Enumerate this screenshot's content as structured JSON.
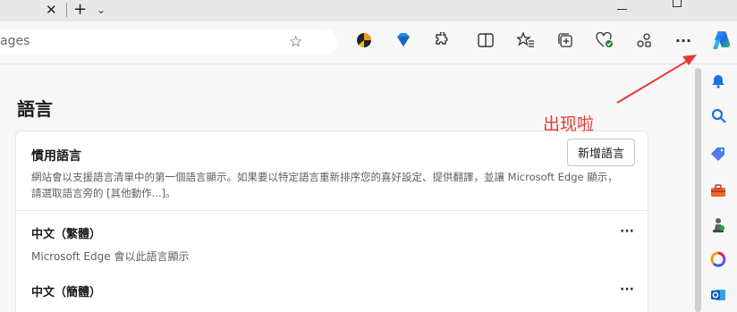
{
  "tabstrip": {
    "close_glyph": "✕",
    "newtab_glyph": "+",
    "tablist_glyph": "⌄"
  },
  "address": {
    "text": "ages"
  },
  "toolbar_icons": [
    "star-icon",
    "extension-colorful-icon",
    "extension-diamond-icon",
    "extensions-icon",
    "split-screen-icon",
    "favorites-icon",
    "collections-icon",
    "browser-essentials-icon",
    "share-icon",
    "more-icon",
    "copilot-icon"
  ],
  "content": {
    "title": "語言",
    "preferred": {
      "heading": "慣用語言",
      "add_button": "新增語言",
      "description": "網站會以支援語言清單中的第一個語言顯示。如果要以特定語言重新排序您的喜好設定、提供翻譯，並讓 Microsoft Edge 顯示，請選取語言旁的 [其他動作...]。"
    },
    "languages": [
      {
        "name": "中文（繁體）",
        "note": "Microsoft Edge 會以此語言顯示"
      },
      {
        "name": "中文（簡體）",
        "note": ""
      }
    ],
    "more_label": "···"
  },
  "annotation": {
    "text": "出现啦",
    "color": "#e53935"
  },
  "sidebar_icons": [
    "bell-icon",
    "search-icon",
    "tag-icon",
    "toolbox-icon",
    "games-icon",
    "office-icon",
    "outlook-icon"
  ]
}
